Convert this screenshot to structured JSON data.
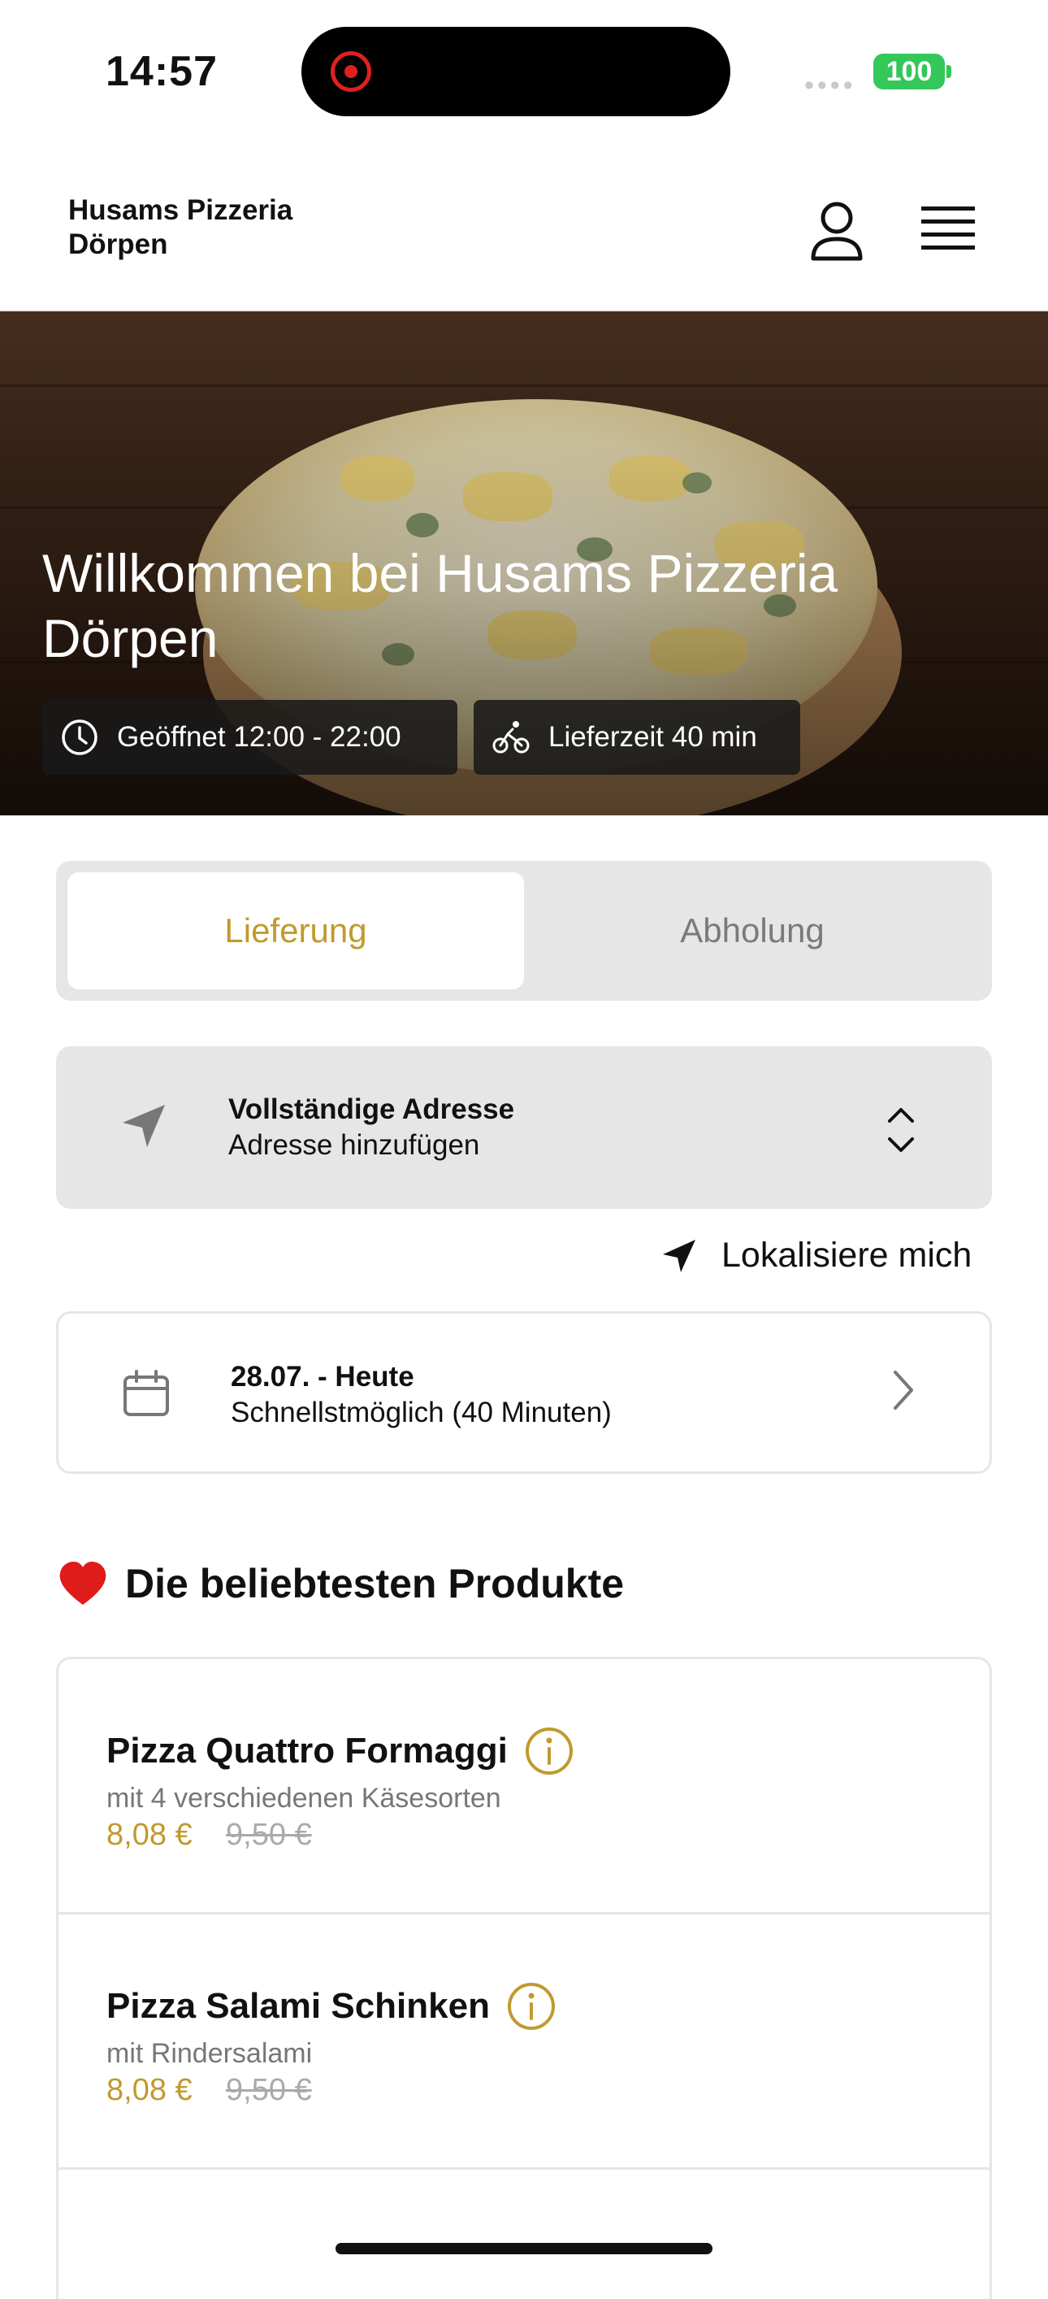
{
  "status_bar": {
    "time": "14:57",
    "signal": "••••",
    "battery": "100"
  },
  "header": {
    "brand_line1": "Husams Pizzeria",
    "brand_line2": "Dörpen",
    "user_icon": "user-icon",
    "menu_icon": "menu-icon"
  },
  "hero": {
    "title": "Willkommen bei Husams Pizzeria Dörpen",
    "hours": "Geöffnet 12:00 - 22:00",
    "delivery_time": "Lieferzeit 40 min"
  },
  "order_mode": {
    "delivery": "Lieferung",
    "pickup": "Abholung",
    "selected": "delivery"
  },
  "address": {
    "title": "Vollständige Adresse",
    "placeholder": "Adresse hinzufügen"
  },
  "locate": {
    "label": "Lokalisiere mich"
  },
  "schedule": {
    "date": "28.07. - Heute",
    "time": "Schnellstmöglich (40 Minuten)"
  },
  "popular": {
    "title": "Die beliebtesten Produkte",
    "products": [
      {
        "name": "Pizza Quattro Formaggi",
        "description": "mit 4 verschiedenen Käsesorten",
        "price": "8,08 €",
        "old_price": "9,50 €"
      },
      {
        "name": "Pizza Salami Schinken",
        "description": "mit Rindersalami",
        "price": "8,08 €",
        "old_price": "9,50 €"
      }
    ]
  },
  "colors": {
    "accent": "#c09a2e",
    "battery": "#34c759",
    "panel": "#e6e6e6"
  }
}
